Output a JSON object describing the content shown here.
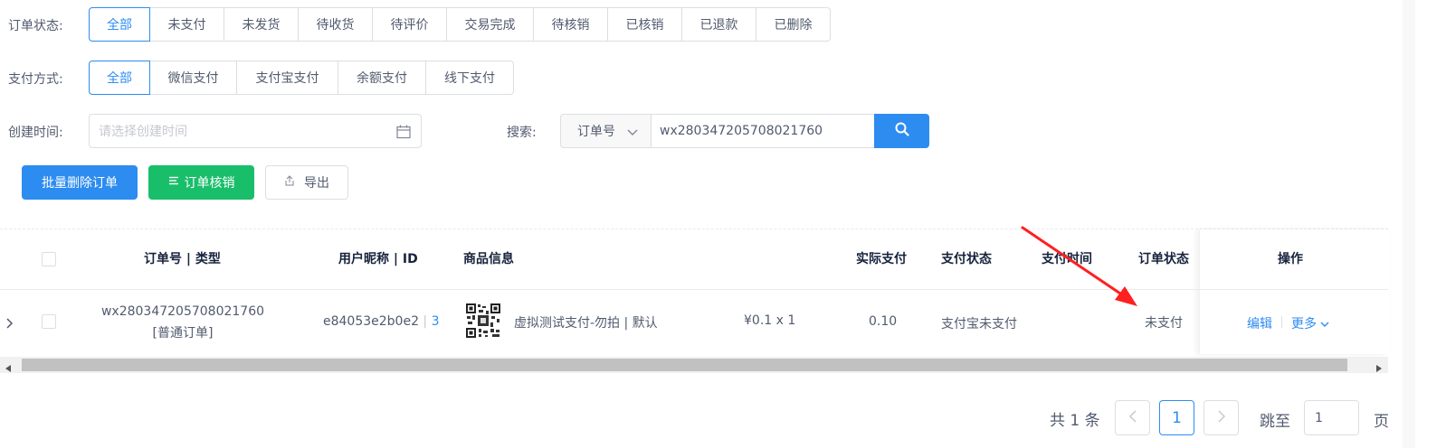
{
  "filters": {
    "order_status": {
      "label": "订单状态:",
      "options": [
        "全部",
        "未支付",
        "未发货",
        "待收货",
        "待评价",
        "交易完成",
        "待核销",
        "已核销",
        "已退款",
        "已删除"
      ]
    },
    "payment_method": {
      "label": "支付方式:",
      "options": [
        "全部",
        "微信支付",
        "支付宝支付",
        "余额支付",
        "线下支付"
      ]
    },
    "created_time": {
      "label": "创建时间:",
      "placeholder": "请选择创建时间"
    },
    "search": {
      "label": "搜索:",
      "field_select": "订单号",
      "value": "wx280347205708021760"
    }
  },
  "actions": {
    "batch_delete": "批量删除订单",
    "verify": "订单核销",
    "export": "导出"
  },
  "table": {
    "headers": {
      "order_no": "订单号 | 类型",
      "user": "用户昵称 | ID",
      "goods": "商品信息",
      "paid": "实际支付",
      "pay_status": "支付状态",
      "pay_time": "支付时间",
      "order_status": "订单状态",
      "ops": "操作"
    },
    "rows": [
      {
        "order_no": "wx280347205708021760",
        "order_type": "[普通订单]",
        "nickname": "e84053e2b0e2",
        "sep": " | ",
        "user_id": "3",
        "goods_name": "虚拟测试支付-勿拍 | 默认",
        "price_qty": "¥0.1 x 1",
        "paid": "0.10",
        "pay_status": "支付宝未支付",
        "order_status": "未支付",
        "edit": "编辑",
        "more": "更多"
      }
    ]
  },
  "pagination": {
    "total": "共 1 条",
    "current": "1",
    "jump_label": "跳至",
    "jump_value": "1",
    "page_unit": "页"
  },
  "colors": {
    "primary": "#2d8cf0",
    "success": "#19be6b",
    "annotation": "#ff2020"
  }
}
